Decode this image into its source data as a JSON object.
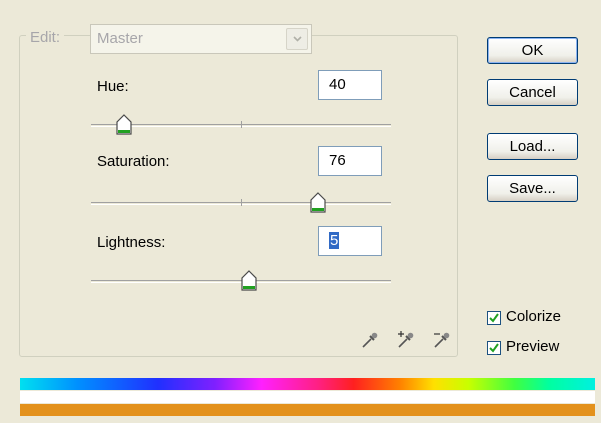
{
  "edit": {
    "label": "Edit:",
    "value": "Master"
  },
  "hue": {
    "label": "Hue:",
    "value": "40",
    "slider_fraction": 0.11
  },
  "saturation": {
    "label": "Saturation:",
    "value": "76",
    "slider_fraction": 0.755
  },
  "lightness": {
    "label": "Lightness:",
    "value": "5",
    "slider_fraction": 0.525
  },
  "buttons": {
    "ok": "OK",
    "cancel": "Cancel",
    "load": "Load...",
    "save": "Save..."
  },
  "checkboxes": {
    "colorize": {
      "label": "Colorize",
      "checked": true
    },
    "preview": {
      "label": "Preview",
      "checked": true
    }
  },
  "colors": {
    "result_color": "#e3911c",
    "check_color": "#21a121"
  },
  "icons": [
    "eyedropper-icon",
    "eyedropper-plus-icon",
    "eyedropper-minus-icon"
  ]
}
